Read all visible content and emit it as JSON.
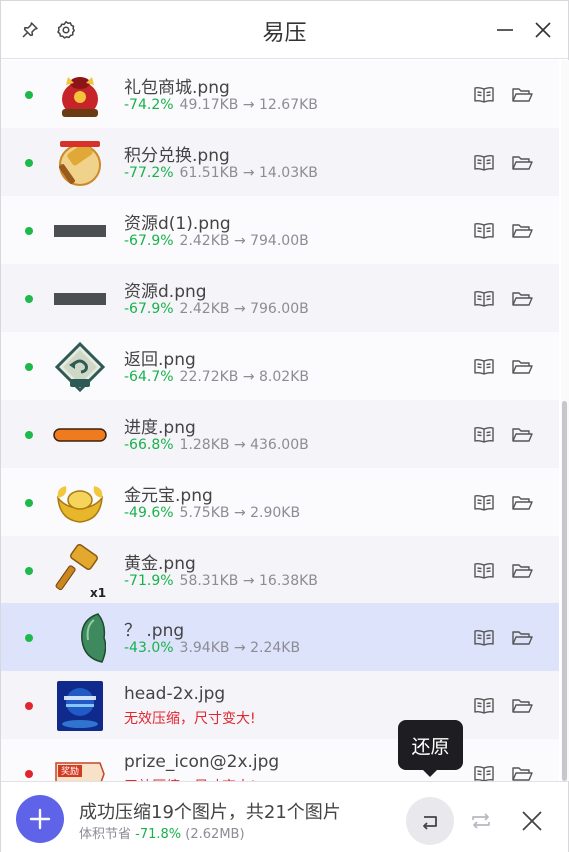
{
  "window": {
    "title": "易压",
    "pin_icon": "pin-icon",
    "settings_icon": "gear-icon",
    "minimize_icon": "minimize-icon",
    "close_icon": "close-icon"
  },
  "files": [
    {
      "name": "礼包商城.png",
      "status": "ok",
      "percent": "-74.2%",
      "sizes": "49.17KB → 12.67KB",
      "thumb": "gift-bag"
    },
    {
      "name": "积分兑换.png",
      "status": "ok",
      "percent": "-77.2%",
      "sizes": "61.51KB → 14.03KB",
      "thumb": "hammer-badge"
    },
    {
      "name": "资源d(1).png",
      "status": "ok",
      "percent": "-67.9%",
      "sizes": "2.42KB → 794.00B",
      "thumb": "dark-bar"
    },
    {
      "name": "资源d.png",
      "status": "ok",
      "percent": "-67.9%",
      "sizes": "2.42KB → 796.00B",
      "thumb": "dark-bar"
    },
    {
      "name": "返回.png",
      "status": "ok",
      "percent": "-64.7%",
      "sizes": "22.72KB → 8.02KB",
      "thumb": "back-diamond"
    },
    {
      "name": "进度.png",
      "status": "ok",
      "percent": "-66.8%",
      "sizes": "1.28KB → 436.00B",
      "thumb": "orange-bar"
    },
    {
      "name": "金元宝.png",
      "status": "ok",
      "percent": "-49.6%",
      "sizes": "5.75KB → 2.90KB",
      "thumb": "gold-ingot"
    },
    {
      "name": "黄金.png",
      "status": "ok",
      "percent": "-71.9%",
      "sizes": "58.31KB → 16.38KB",
      "thumb": "gold-hammer"
    },
    {
      "name": "？ .png",
      "status": "ok",
      "percent": "-43.0%",
      "sizes": "3.94KB → 2.24KB",
      "thumb": "jade",
      "selected": true
    },
    {
      "name": "head-2x.jpg",
      "status": "bad",
      "percent": "",
      "sizes": "",
      "error": "无效压缩，尺寸变大!",
      "thumb": "blue-card"
    },
    {
      "name": "prize_icon@2x.jpg",
      "status": "bad",
      "percent": "",
      "sizes": "",
      "error": "无效压缩，尺寸变大!",
      "thumb": "prize-scroll"
    }
  ],
  "prize_thumb_text": "奖励",
  "row_actions": {
    "preview_icon": "book-icon",
    "folder_icon": "folder-open-icon"
  },
  "footer": {
    "summary": "成功压缩19个图片，共21个图片",
    "saved_label": "体积节省",
    "saved_percent": "-71.8%",
    "saved_size": "(2.62MB)",
    "add_icon": "plus-icon",
    "restore_icon": "restore-icon",
    "redo_icon": "repeat-icon",
    "clear_icon": "close-icon"
  },
  "tooltip": {
    "text": "还原"
  },
  "colors": {
    "accent": "#5e63e8",
    "success": "#17b24a",
    "error": "#e0262f",
    "selected_row": "#dde3fb"
  }
}
